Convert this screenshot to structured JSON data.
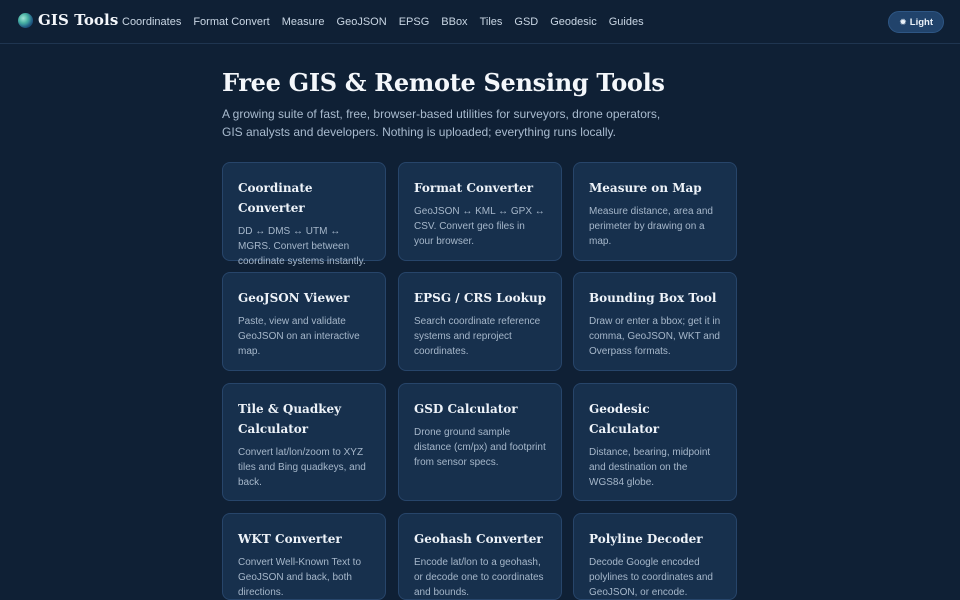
{
  "header": {
    "brand": "GIS Tools",
    "nav": [
      "Coordinates",
      "Format Convert",
      "Measure",
      "GeoJSON",
      "EPSG",
      "BBox",
      "Tiles",
      "GSD",
      "Geodesic",
      "Guides"
    ],
    "theme_toggle": "Light",
    "theme_icon": "sun-icon"
  },
  "hero": {
    "title": "Free GIS & Remote Sensing Tools",
    "subtitle": "A growing suite of fast, free, browser-based utilities for surveyors, drone operators, GIS analysts and developers. Nothing is uploaded; everything runs locally."
  },
  "cards": [
    {
      "title": "Coordinate Converter",
      "desc": "DD ↔ DMS ↔ UTM ↔ MGRS. Convert between coordinate systems instantly."
    },
    {
      "title": "Format Converter",
      "desc": "GeoJSON ↔ KML ↔ GPX ↔ CSV. Convert geo files in your browser."
    },
    {
      "title": "Measure on Map",
      "desc": "Measure distance, area and perimeter by drawing on a map."
    },
    {
      "title": "GeoJSON Viewer",
      "desc": "Paste, view and validate GeoJSON on an interactive map."
    },
    {
      "title": "EPSG / CRS Lookup",
      "desc": "Search coordinate reference systems and reproject coordinates."
    },
    {
      "title": "Bounding Box Tool",
      "desc": "Draw or enter a bbox; get it in comma, GeoJSON, WKT and Overpass formats."
    },
    {
      "title": "Tile & Quadkey Calculator",
      "desc": "Convert lat/lon/zoom to XYZ tiles and Bing quadkeys, and back."
    },
    {
      "title": "GSD Calculator",
      "desc": "Drone ground sample distance (cm/px) and footprint from sensor specs."
    },
    {
      "title": "Geodesic Calculator",
      "desc": "Distance, bearing, midpoint and destination on the WGS84 globe."
    },
    {
      "title": "WKT Converter",
      "desc": "Convert Well-Known Text to GeoJSON and back, both directions."
    },
    {
      "title": "Geohash Converter",
      "desc": "Encode lat/lon to a geohash, or decode one to coordinates and bounds."
    },
    {
      "title": "Polyline Decoder",
      "desc": "Decode Google encoded polylines to coordinates and GeoJSON, or encode."
    }
  ]
}
